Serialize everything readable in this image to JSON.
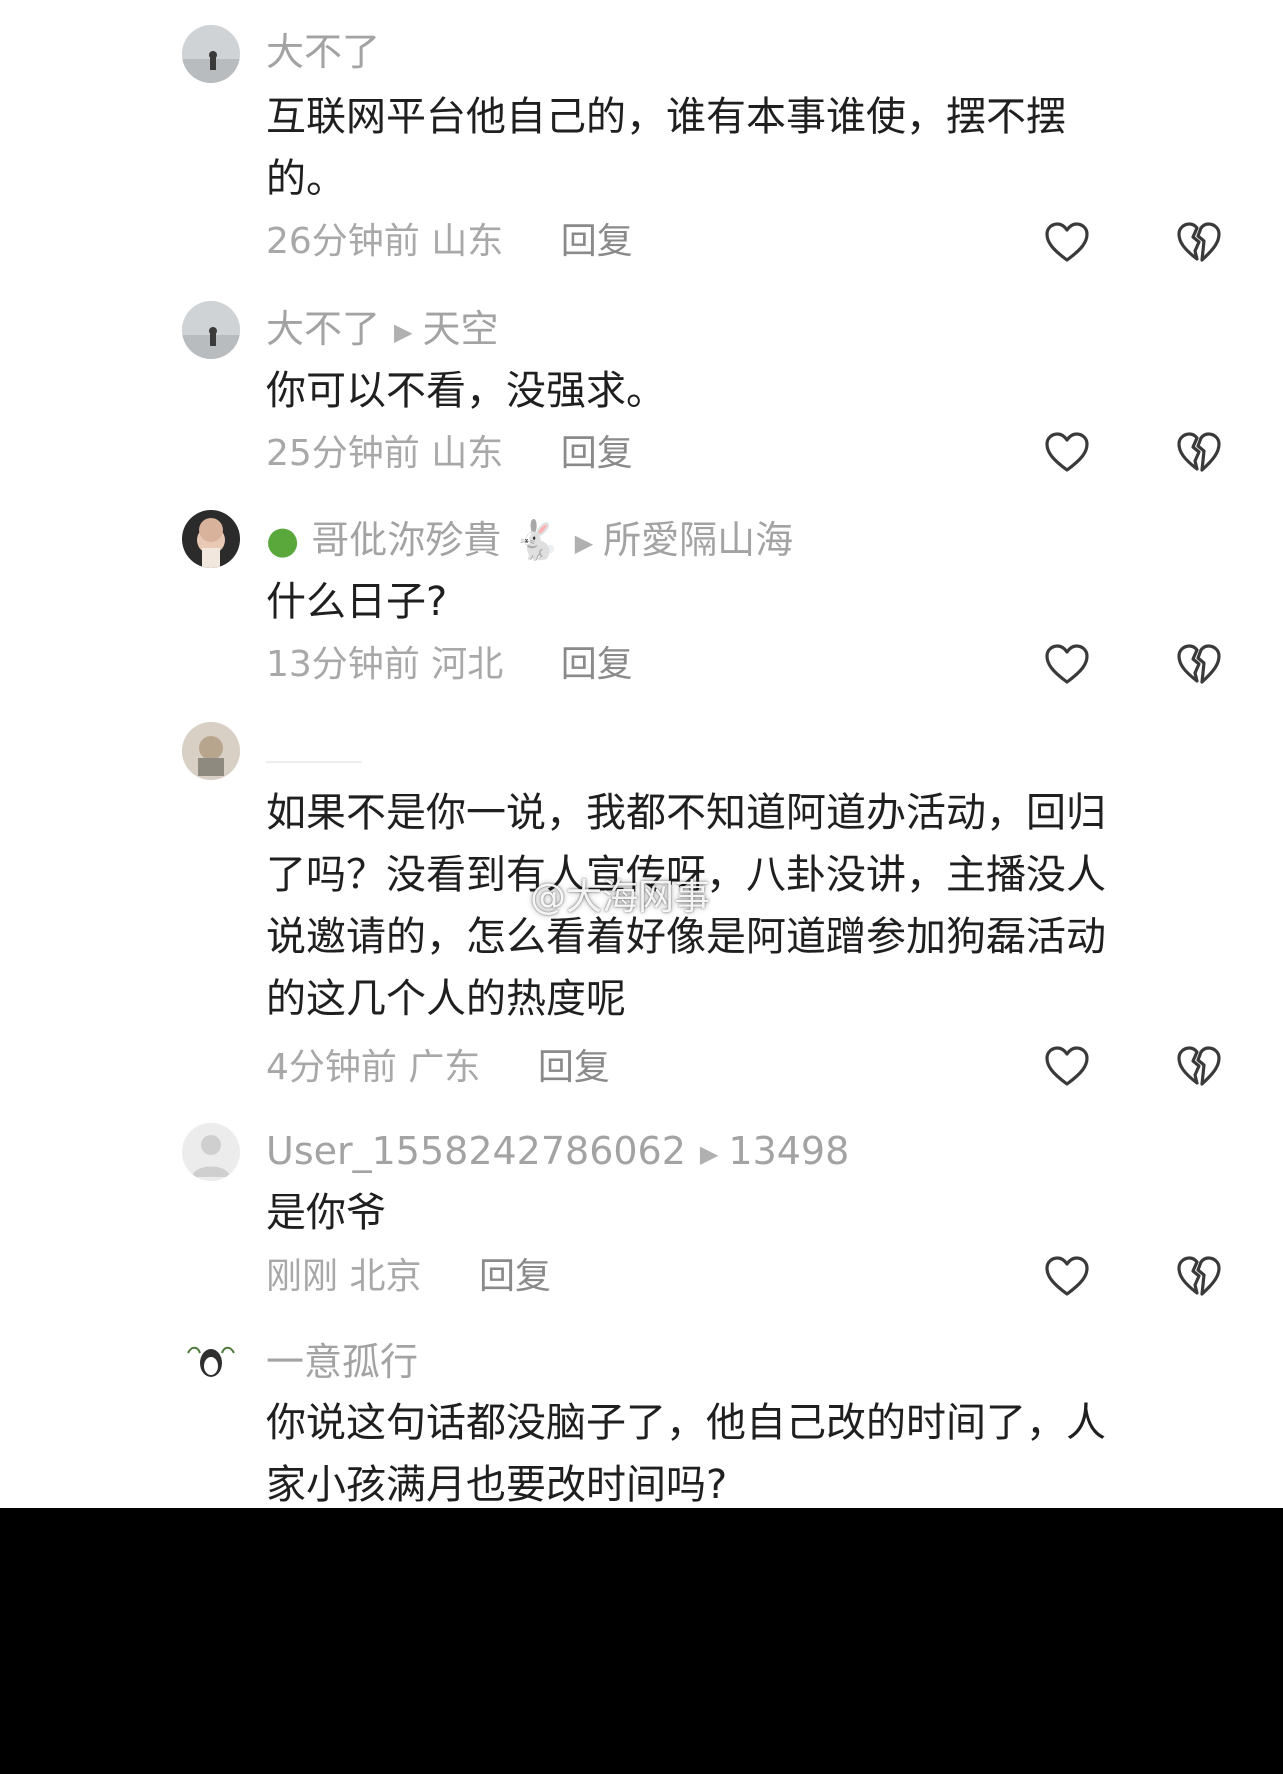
{
  "comments": [
    {
      "author": "大不了",
      "reply_to": "",
      "text": "互联网平台他自己的，谁有本事谁使，摆不摆\n的。",
      "time": "26分钟前",
      "location": "山东",
      "reply_label": "回复"
    },
    {
      "author": "大不了",
      "reply_to": "天空",
      "text": "你可以不看，没强求。",
      "time": "25分钟前",
      "location": "山东",
      "reply_label": "回复"
    },
    {
      "author": "哥仳沵殄貴",
      "reply_to": "所愛隔山海",
      "text": "什么日子?",
      "time": "13分钟前",
      "location": "河北",
      "reply_label": "回复"
    },
    {
      "author": "",
      "reply_to": "",
      "text": "如果不是你一说，我都不知道阿道办活动，回归\n了吗？没看到有人宣传呀，八卦没讲，主播没人\n说邀请的，怎么看着好像是阿道蹭参加狗磊活动\n的这几个人的热度呢",
      "time": "4分钟前",
      "location": "广东",
      "reply_label": "回复"
    },
    {
      "author": "User_1558242786062",
      "reply_to": "13498",
      "text": "是你爷",
      "time": "刚刚",
      "location": "北京",
      "reply_label": "回复"
    },
    {
      "author": "一意孤行",
      "reply_to": "",
      "text": "你说这句话都没脑子了，他自己改的时间了，人\n家小孩满月也要改时间吗?",
      "time": "",
      "location": "",
      "reply_label": ""
    }
  ],
  "watermark": "@大海网事",
  "icons": {
    "like": "heart-outline-icon",
    "dislike": "broken-heart-icon"
  }
}
